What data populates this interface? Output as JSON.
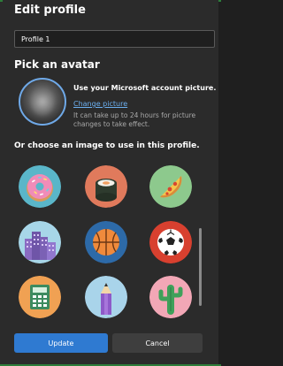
{
  "dialog": {
    "title": "Edit profile",
    "profile_name_value": "Profile 1",
    "avatar_section_title": "Pick an avatar"
  },
  "account_picture": {
    "title": "Use your Microsoft account picture.",
    "link": "Change picture",
    "note": "It can take up to 24 hours for picture changes to take effect."
  },
  "gallery": {
    "prompt": "Or choose an image to use in this profile.",
    "avatars": [
      {
        "icon": "donut-icon",
        "bg": "#5ab6c9"
      },
      {
        "icon": "sushi-icon",
        "bg": "#e07a5c"
      },
      {
        "icon": "pizza-icon",
        "bg": "#8dc98d"
      },
      {
        "icon": "city-icon",
        "bg": "#a7d6e8"
      },
      {
        "icon": "basketball-icon",
        "bg": "#2d6aa8"
      },
      {
        "icon": "soccer-ball-icon",
        "bg": "#d8402f"
      },
      {
        "icon": "calculator-icon",
        "bg": "#f0a153"
      },
      {
        "icon": "pencil-icon",
        "bg": "#a9d4ea"
      },
      {
        "icon": "cactus-icon",
        "bg": "#f2a7b6"
      }
    ]
  },
  "buttons": {
    "update": "Update",
    "cancel": "Cancel"
  },
  "colors": {
    "accent": "#2f7ad1",
    "link": "#6cb0f0",
    "window_border": "#2d7d3a"
  }
}
